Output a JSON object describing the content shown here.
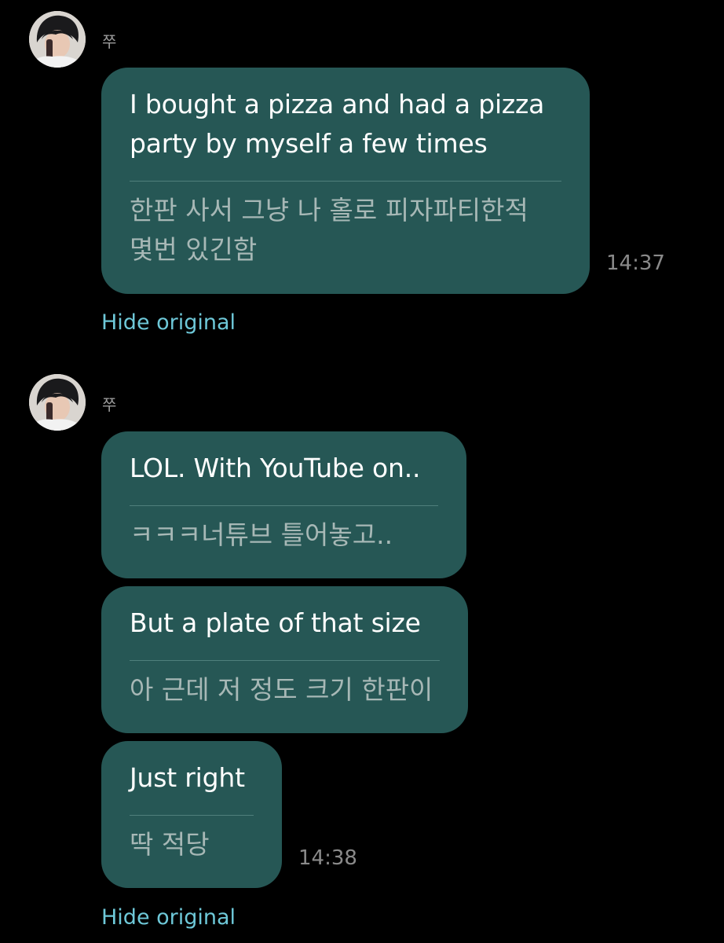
{
  "messages": [
    {
      "sender": "쭈",
      "bubbles": [
        {
          "translated": "I bought a pizza and had a pizza\nparty by myself a few times",
          "original": "한판 사서 그냥 나 홀로 피자파티한적\n몇번 있긴함"
        }
      ],
      "time": "14:37",
      "hide_label": "Hide original"
    },
    {
      "sender": "쭈",
      "bubbles": [
        {
          "translated": "LOL. With YouTube on..",
          "original": "ㅋㅋㅋ너튜브 틀어놓고.."
        },
        {
          "translated": "But a plate of that size",
          "original": "아 근데 저 정도 크기 한판이"
        },
        {
          "translated": "Just right",
          "original": "딱 적당"
        }
      ],
      "time": "14:38",
      "hide_label": "Hide original"
    }
  ],
  "colors": {
    "background": "#000000",
    "bubble": "#265755",
    "link": "#6ec8d8",
    "original_text": "#a7b8b6"
  },
  "icons": {
    "avatar": "avatar-photo"
  }
}
